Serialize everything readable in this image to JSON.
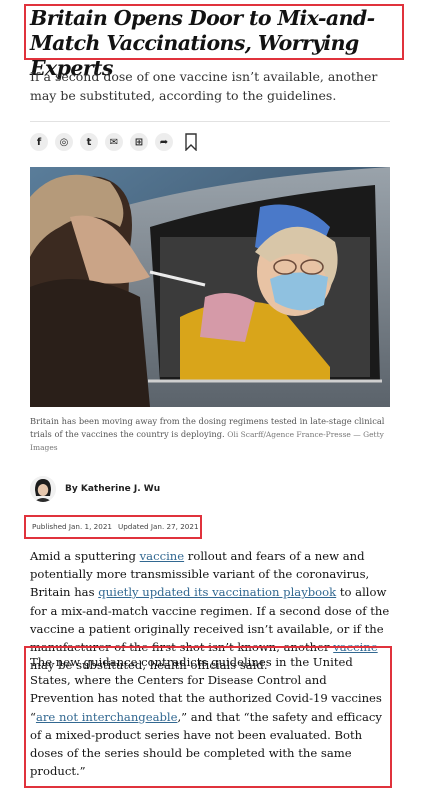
{
  "article": {
    "headline": "Britain Opens Door to Mix-and-Match Vaccinations, Worrying Experts",
    "summary": "If a second dose of one vaccine isn’t available, another may be substituted, according to the guidelines."
  },
  "share": {
    "icons": [
      "facebook-icon",
      "whatsapp-icon",
      "twitter-icon",
      "email-icon",
      "gift-icon",
      "share-icon",
      "bookmark-icon"
    ],
    "glyphs": [
      "f",
      "◎",
      "t",
      "✉",
      "⊞",
      "➦"
    ]
  },
  "photo": {
    "caption": "Britain has been moving away from the dosing regimens tested in late-stage clinical trials of the vaccines the country is deploying.",
    "credit": "Oli Scarff/Agence France-Presse — Getty Images"
  },
  "byline": {
    "author": "By Katherine J. Wu"
  },
  "dates": {
    "published": "Published Jan. 1, 2021",
    "updated": "Updated Jan. 27, 2021"
  },
  "body": {
    "p1": {
      "t1": "Amid a sputtering ",
      "l1": "vaccine",
      "t2": " rollout and fears of a new and potentially more transmissible variant of the coronavirus, Britain has ",
      "l2": "quietly updated its vaccination playbook",
      "t3": " to allow for a mix-and-match vaccine regimen. If a second dose of the vaccine a patient originally received isn’t available, or if the manufacturer of the first shot isn’t known, another ",
      "l3": "vaccine",
      "t4": " may be substituted, health officials said."
    },
    "p2": {
      "t1": "The new guidance contradicts guidelines in the United States, where the Centers for Disease Control and Prevention has noted that the authorized Covid-19 vaccines “",
      "l1": "are not interchangeable",
      "t2": ",” and that “the safety and efficacy of a mixed-product series have not been evaluated. Both doses of the series should be completed with the same product.”"
    }
  },
  "colors": {
    "highlight": "#e0323c",
    "link": "#326891",
    "text": "#121212"
  }
}
